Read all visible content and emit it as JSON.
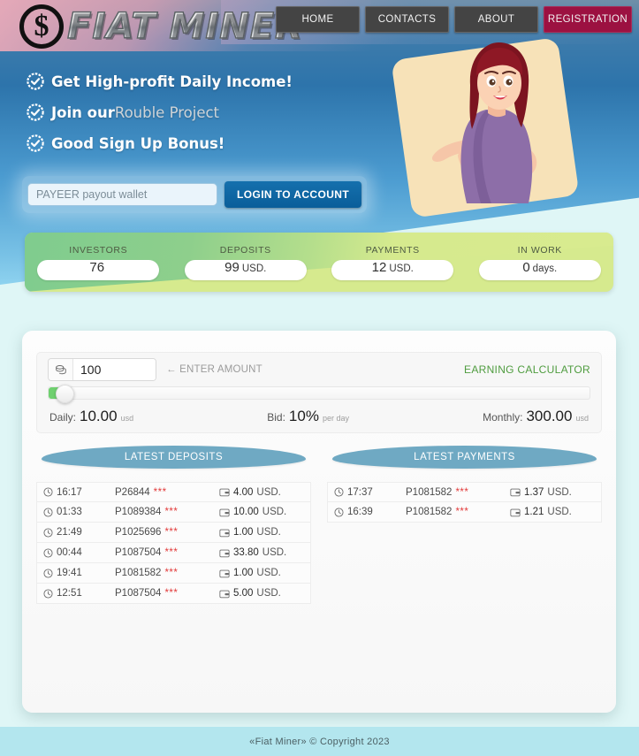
{
  "site": {
    "logo_symbol": "$",
    "logo_text": "FIAT MINER"
  },
  "nav": {
    "items": [
      {
        "label": "HOME",
        "kind": "normal"
      },
      {
        "label": "CONTACTS",
        "kind": "normal"
      },
      {
        "label": "ABOUT",
        "kind": "normal"
      },
      {
        "label": "REGISTRATION",
        "kind": "accent"
      }
    ],
    "accent_color": "#9c1141",
    "normal_color": "#444444"
  },
  "hero": {
    "benefits": [
      {
        "icon": "check-badge-icon",
        "text": "Get High-profit Daily Income!",
        "link": ""
      },
      {
        "icon": "check-badge-icon",
        "text": "Join our ",
        "link": "Rouble Project"
      },
      {
        "icon": "check-badge-icon",
        "text": "Good Sign Up Bonus!",
        "link": ""
      }
    ],
    "login": {
      "placeholder": "PAYEER payout wallet",
      "value": "",
      "button_label": "LOGIN TO ACCOUNT"
    }
  },
  "stats": [
    {
      "label": "INVESTORS",
      "value": "76",
      "unit": ""
    },
    {
      "label": "DEPOSITS",
      "value": "99",
      "unit": "USD."
    },
    {
      "label": "PAYMENTS",
      "value": "12",
      "unit": "USD."
    },
    {
      "label": "IN WORK",
      "value": "0",
      "unit": "days."
    }
  ],
  "calculator": {
    "title": "EARNING CALCULATOR",
    "amount_value": "100",
    "amount_placeholder": "100",
    "amount_icon": "coins-icon",
    "enter_amount_hint": "← ENTER AMOUNT",
    "slider_percent": 1,
    "daily": {
      "label": "Daily:",
      "value": "10.00",
      "unit": "usd"
    },
    "bid": {
      "label": "Bid:",
      "value": "10%",
      "unit": "per day"
    },
    "monthly": {
      "label": "Monthly:",
      "value": "300.00",
      "unit": "usd"
    },
    "accent_color": "#4f9c3f"
  },
  "tables": {
    "header_color": "#6fa9c3",
    "deposits": {
      "title": "LATEST DEPOSITS",
      "rows": [
        {
          "time": "16:17",
          "account": "P26844",
          "stars": "***",
          "amount": "4.00",
          "currency": "USD."
        },
        {
          "time": "01:33",
          "account": "P1089384",
          "stars": "***",
          "amount": "10.00",
          "currency": "USD."
        },
        {
          "time": "21:49",
          "account": "P1025696",
          "stars": "***",
          "amount": "1.00",
          "currency": "USD."
        },
        {
          "time": "00:44",
          "account": "P1087504",
          "stars": "***",
          "amount": "33.80",
          "currency": "USD."
        },
        {
          "time": "19:41",
          "account": "P1081582",
          "stars": "***",
          "amount": "1.00",
          "currency": "USD."
        },
        {
          "time": "12:51",
          "account": "P1087504",
          "stars": "***",
          "amount": "5.00",
          "currency": "USD."
        }
      ]
    },
    "payments": {
      "title": "LATEST PAYMENTS",
      "rows": [
        {
          "time": "17:37",
          "account": "P1081582",
          "stars": "***",
          "amount": "1.37",
          "currency": "USD."
        },
        {
          "time": "16:39",
          "account": "P1081582",
          "stars": "***",
          "amount": "1.21",
          "currency": "USD."
        }
      ]
    }
  },
  "footer": {
    "text": "«Fiat Miner» © Copyright 2023"
  }
}
